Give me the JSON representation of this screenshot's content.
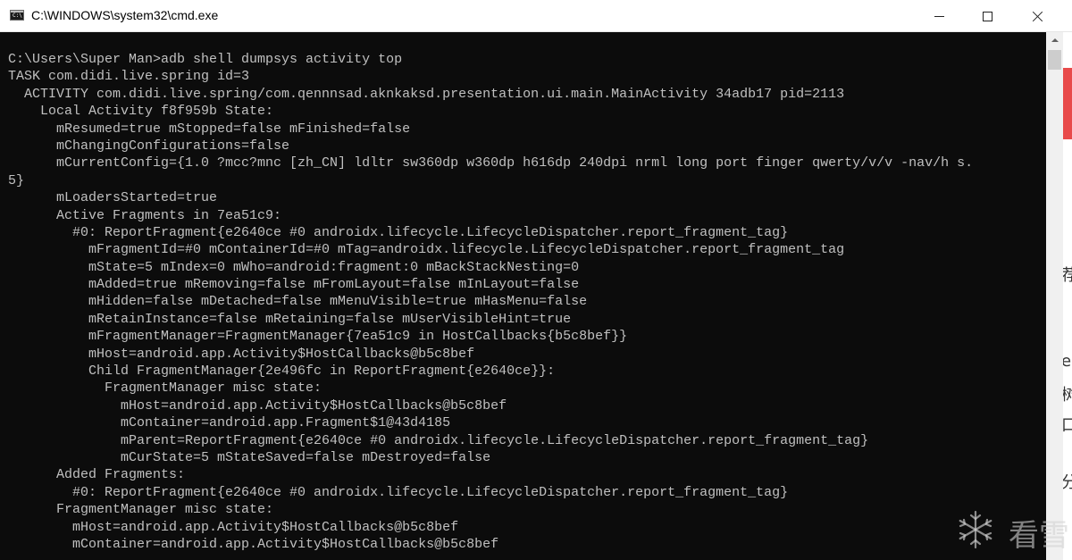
{
  "window": {
    "title": "C:\\WINDOWS\\system32\\cmd.exe",
    "icon_label": "C:\\"
  },
  "console": {
    "lines": [
      "C:\\Users\\Super Man>adb shell dumpsys activity top",
      "TASK com.didi.live.spring id=3",
      "  ACTIVITY com.didi.live.spring/com.qennnsad.aknkaksd.presentation.ui.main.MainActivity 34adb17 pid=2113",
      "    Local Activity f8f959b State:",
      "      mResumed=true mStopped=false mFinished=false",
      "      mChangingConfigurations=false",
      "      mCurrentConfig={1.0 ?mcc?mnc [zh_CN] ldltr sw360dp w360dp h616dp 240dpi nrml long port finger qwerty/v/v -nav/h s.",
      "5}",
      "      mLoadersStarted=true",
      "      Active Fragments in 7ea51c9:",
      "        #0: ReportFragment{e2640ce #0 androidx.lifecycle.LifecycleDispatcher.report_fragment_tag}",
      "          mFragmentId=#0 mContainerId=#0 mTag=androidx.lifecycle.LifecycleDispatcher.report_fragment_tag",
      "          mState=5 mIndex=0 mWho=android:fragment:0 mBackStackNesting=0",
      "          mAdded=true mRemoving=false mFromLayout=false mInLayout=false",
      "          mHidden=false mDetached=false mMenuVisible=true mHasMenu=false",
      "          mRetainInstance=false mRetaining=false mUserVisibleHint=true",
      "          mFragmentManager=FragmentManager{7ea51c9 in HostCallbacks{b5c8bef}}",
      "          mHost=android.app.Activity$HostCallbacks@b5c8bef",
      "          Child FragmentManager{2e496fc in ReportFragment{e2640ce}}:",
      "            FragmentManager misc state:",
      "              mHost=android.app.Activity$HostCallbacks@b5c8bef",
      "              mContainer=android.app.Fragment$1@43d4185",
      "              mParent=ReportFragment{e2640ce #0 androidx.lifecycle.LifecycleDispatcher.report_fragment_tag}",
      "              mCurState=5 mStateSaved=false mDestroyed=false",
      "      Added Fragments:",
      "        #0: ReportFragment{e2640ce #0 androidx.lifecycle.LifecycleDispatcher.report_fragment_tag}",
      "      FragmentManager misc state:",
      "        mHost=android.app.Activity$HostCallbacks@b5c8bef",
      "        mContainer=android.app.Activity$HostCallbacks@b5c8bef"
    ]
  },
  "background": {
    "chars": [
      "荐",
      "e",
      "树",
      "口",
      "分"
    ]
  },
  "watermark": {
    "text": "看雪"
  },
  "colors": {
    "console_bg": "#0c0c0c",
    "console_fg": "#c0c0c0",
    "titlebar_bg": "#ffffff"
  },
  "icons": {
    "minimize": "minimize-icon",
    "maximize": "maximize-icon",
    "close": "close-icon",
    "app": "cmd-app-icon",
    "scroll_up": "chevron-up-icon",
    "watermark": "snowflake-icon"
  }
}
